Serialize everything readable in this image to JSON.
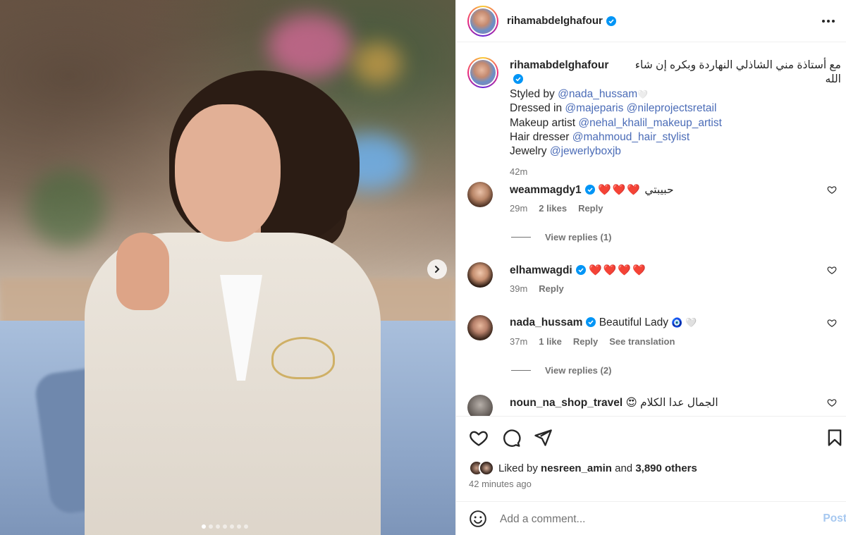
{
  "post": {
    "author": "rihamabdelghafour",
    "more_icon": "more-horizontal-icon"
  },
  "caption": {
    "username": "rihamabdelghafour",
    "arabic_line": "مع أستاذة مني الشاذلي النهاردة وبكره إن شاء الله",
    "emoji_after_arabic": "🤍",
    "styled_by_label": "Styled by",
    "styled_by_handle": "@nada_hussam",
    "dressed_in_label": "Dressed in",
    "dressed_in_handle_1": "@majeparis",
    "dressed_in_handle_2": "@nileprojectsretail",
    "makeup_label": "Makeup artist",
    "makeup_handle": "@nehal_khalil_makeup_artist",
    "hair_label": "Hair dresser",
    "hair_handle": "@mahmoud_hair_stylist",
    "jewelry_label": "Jewelry",
    "jewelry_handle": "@jewerlyboxjb",
    "time": "42m"
  },
  "comments": [
    {
      "username": "weammagdy1",
      "text": "حبيبتي",
      "hearts": "❤️❤️❤️",
      "time": "29m",
      "likes": "2 likes",
      "reply": "Reply",
      "view_replies": "View replies (1)"
    },
    {
      "username": "elhamwagdi",
      "hearts": "❤️❤️❤️❤️",
      "time": "39m",
      "reply": "Reply"
    },
    {
      "username": "nada_hussam",
      "text": "Beautiful Lady",
      "emoji": "🧿 🤍",
      "time": "37m",
      "likes": "1 like",
      "reply": "Reply",
      "translation": "See translation",
      "view_replies": "View replies (2)"
    },
    {
      "username": "noun_na_shop_travel",
      "text": "الجمال عدا الكلام",
      "emoji": "😍"
    }
  ],
  "footer": {
    "liked_by_prefix": "Liked by",
    "liked_by_user": "nesreen_amin",
    "liked_by_and": "and",
    "liked_by_others": "3,890 others",
    "posted_ago": "42 minutes ago",
    "comment_placeholder": "Add a comment...",
    "post_label": "Post"
  },
  "colors": {
    "link": "#4b6cb7",
    "verified": "#0095f6",
    "post_button_disabled": "#a6c8f0"
  }
}
